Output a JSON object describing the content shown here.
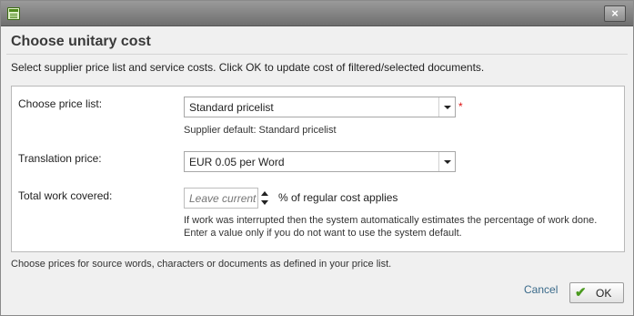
{
  "window": {
    "close_glyph": "×"
  },
  "dialog": {
    "title": "Choose unitary cost",
    "intro": "Select supplier price list and service costs. Click OK to update cost of filtered/selected documents."
  },
  "form": {
    "price_list": {
      "label": "Choose price list:",
      "value": "Standard pricelist",
      "required_mark": "*",
      "hint": "Supplier default: Standard pricelist"
    },
    "translation_price": {
      "label": "Translation price:",
      "value": "EUR 0.05 per Word"
    },
    "work_covered": {
      "label": "Total work covered:",
      "placeholder": "Leave current",
      "unit": "% of regular cost applies",
      "hint_line1": "If work was interrupted then the system automatically estimates the percentage of work done.",
      "hint_line2": "Enter a value only if you do not want to use the system default."
    }
  },
  "footer": {
    "note": "Choose prices for source words, characters or documents as defined in your price list.",
    "cancel_label": "Cancel",
    "ok_label": "OK"
  },
  "icons": {
    "app": "document-list-icon",
    "close": "close-icon",
    "ok": "check-icon",
    "dropdown": "chevron-down-icon",
    "spinner_up": "arrow-up-icon",
    "spinner_down": "arrow-down-icon"
  },
  "colors": {
    "titlebar": "#7f7f7f",
    "accent_green": "#4a9a1f",
    "required": "#dd1111",
    "link": "#3a6a8a"
  }
}
